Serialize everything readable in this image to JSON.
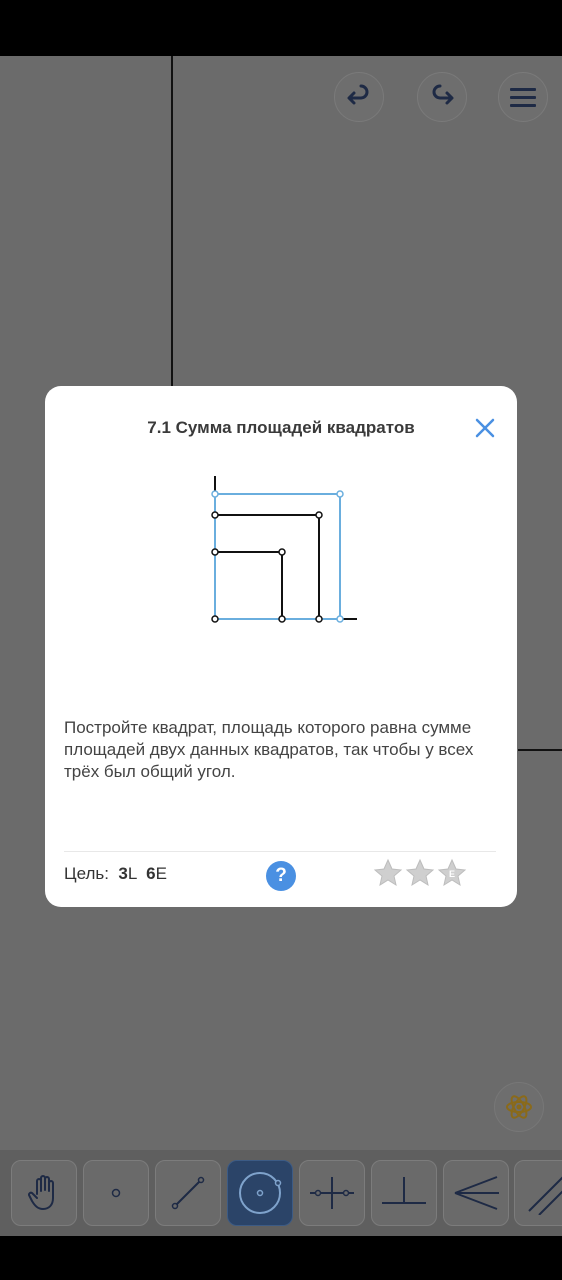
{
  "dialog": {
    "title": "7.1 Сумма площадей квадратов",
    "description": "Постройте квадрат, площадь которого равна сумме площадей двух данных квадратов, так чтобы у всех трёх был общий угол.",
    "goal": {
      "label": "Цель:",
      "l_count": "3",
      "l_unit": "L",
      "e_count": "6",
      "e_unit": "E"
    },
    "help_label": "?",
    "stars": [
      {
        "badge": "",
        "filled": false
      },
      {
        "badge": "",
        "filled": false
      },
      {
        "badge": "E",
        "filled": false
      }
    ]
  },
  "colors": {
    "accent": "#4a90e2",
    "overlay": "#6b6b6b",
    "dialog_bg": "#ffffff",
    "construction_blue": "#6aaede",
    "tool_active": "#2b4468"
  },
  "icons": {
    "undo": "undo-icon",
    "redo": "redo-icon",
    "menu": "hamburger-menu-icon",
    "close": "close-icon",
    "atom": "atom-icon",
    "tools": [
      "hand-icon",
      "point-icon",
      "line-icon",
      "circle-icon",
      "perpendicular-bisector-icon",
      "perpendicular-icon",
      "angle-bisector-icon",
      "parallel-icon"
    ]
  }
}
